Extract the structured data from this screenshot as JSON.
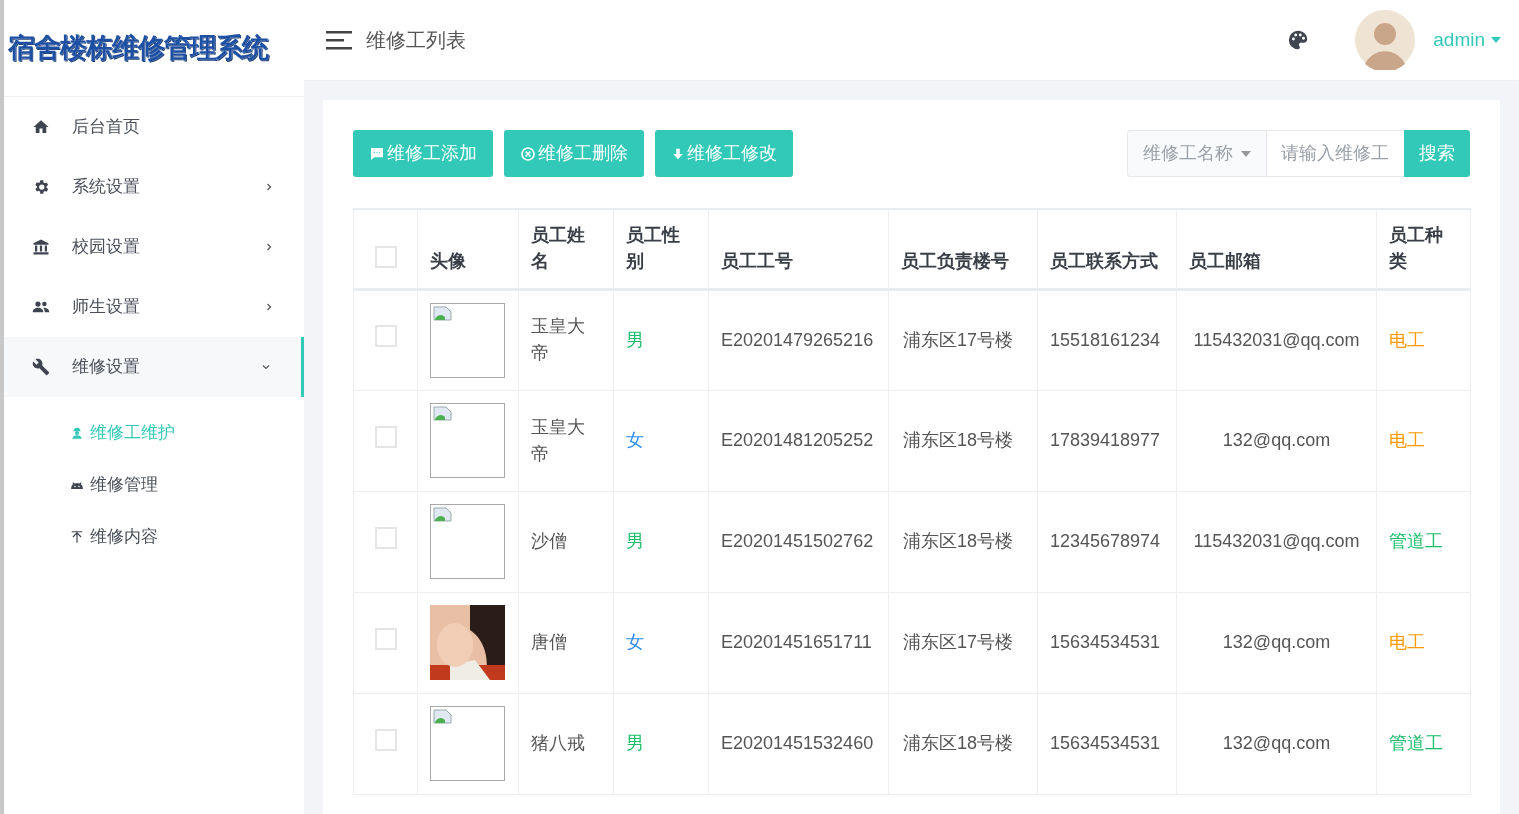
{
  "logo": "宿舍楼栋维修管理系统",
  "header": {
    "page_title": "维修工列表",
    "user": "admin"
  },
  "sidebar": {
    "items": [
      {
        "label": "后台首页",
        "selected": false
      },
      {
        "label": "系统设置",
        "expanded": false,
        "selected": false
      },
      {
        "label": "校园设置",
        "expanded": false,
        "selected": false
      },
      {
        "label": "师生设置",
        "expanded": false,
        "selected": false
      },
      {
        "label": "维修设置",
        "expanded": true,
        "selected": true,
        "children": [
          {
            "label": "维修工维护",
            "selected": true
          },
          {
            "label": "维修管理",
            "selected": false
          },
          {
            "label": "维修内容",
            "selected": false
          }
        ]
      }
    ]
  },
  "toolbar": {
    "buttons": [
      {
        "label": "维修工添加"
      },
      {
        "label": "维修工删除"
      },
      {
        "label": "维修工修改"
      }
    ],
    "search": {
      "filter": "维修工名称",
      "placeholder": "请输入维修工",
      "button": "搜索"
    }
  },
  "table": {
    "header_checked": false,
    "columns": [
      "头像",
      "员工姓名",
      "员工性别",
      "员工工号",
      "员工负责楼号",
      "员工联系方式",
      "员工邮箱",
      "员工种类"
    ],
    "rows": [
      {
        "checked": false,
        "avatar": {
          "kind": "broken"
        },
        "name": "玉皇大帝",
        "gender": {
          "text": "男",
          "color": "#19be6b"
        },
        "id": "E20201479265216",
        "building": "浦东区17号楼",
        "phone": "15518161234",
        "email": "115432031@qq.com",
        "type": {
          "text": "电工",
          "color": "#ff9900"
        }
      },
      {
        "checked": false,
        "avatar": {
          "kind": "broken"
        },
        "name": "玉皇大帝",
        "gender": {
          "text": "女",
          "color": "#2d8cf0"
        },
        "id": "E20201481205252",
        "building": "浦东区18号楼",
        "phone": "17839418977",
        "email": "132@qq.com",
        "type": {
          "text": "电工",
          "color": "#ff9900"
        }
      },
      {
        "checked": false,
        "avatar": {
          "kind": "broken"
        },
        "name": "沙僧",
        "gender": {
          "text": "男",
          "color": "#19be6b"
        },
        "id": "E20201451502762",
        "building": "浦东区18号楼",
        "phone": "12345678974",
        "email": "115432031@qq.com",
        "type": {
          "text": "管道工",
          "color": "#19be6b"
        }
      },
      {
        "checked": false,
        "name": "唐僧",
        "gender": {
          "text": "女",
          "color": "#2d8cf0"
        },
        "id": "E20201451651711",
        "building": "浦东区17号楼",
        "phone": "15634534531",
        "email": "132@qq.com",
        "type": {
          "text": "电工",
          "color": "#ff9900"
        }
      },
      {
        "checked": false,
        "avatar": {
          "kind": "broken"
        },
        "name": "猪八戒",
        "gender": {
          "text": "男",
          "color": "#19be6b"
        },
        "id": "E20201451532460",
        "building": "浦东区18号楼",
        "phone": "15634534531",
        "email": "132@qq.com",
        "type": {
          "text": "管道工",
          "color": "#19be6b"
        }
      }
    ]
  }
}
